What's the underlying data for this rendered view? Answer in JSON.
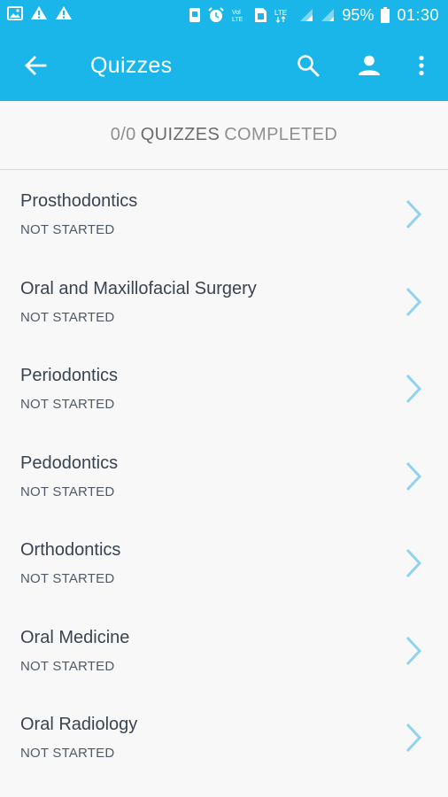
{
  "status_bar": {
    "battery": "95%",
    "time": "01:30",
    "icons": [
      "image-icon",
      "warning-icon",
      "warning-icon",
      "nfc-icon",
      "alarm-icon",
      "volte-icon",
      "sim-icon",
      "lte-icon",
      "signal-icon",
      "signal-icon",
      "battery-icon"
    ]
  },
  "app_bar": {
    "title": "Quizzes",
    "back_icon": "arrow-back-icon",
    "actions": [
      "search-icon",
      "person-icon",
      "more-vert-icon"
    ]
  },
  "summary": {
    "count": "0/0",
    "label_bold": "QUIZZES",
    "label_rest": "COMPLETED"
  },
  "quizzes": [
    {
      "title": "Prosthodontics",
      "status": "NOT STARTED"
    },
    {
      "title": "Oral and Maxillofacial Surgery",
      "status": "NOT STARTED"
    },
    {
      "title": "Periodontics",
      "status": "NOT STARTED"
    },
    {
      "title": "Pedodontics",
      "status": "NOT STARTED"
    },
    {
      "title": "Orthodontics",
      "status": "NOT STARTED"
    },
    {
      "title": "Oral Medicine",
      "status": "NOT STARTED"
    },
    {
      "title": "Oral Radiology",
      "status": "NOT STARTED"
    }
  ],
  "colors": {
    "primary": "#1ab6ea",
    "chevron": "#8fd3ee",
    "text": "#3a4350",
    "muted": "#8f8f8f"
  }
}
